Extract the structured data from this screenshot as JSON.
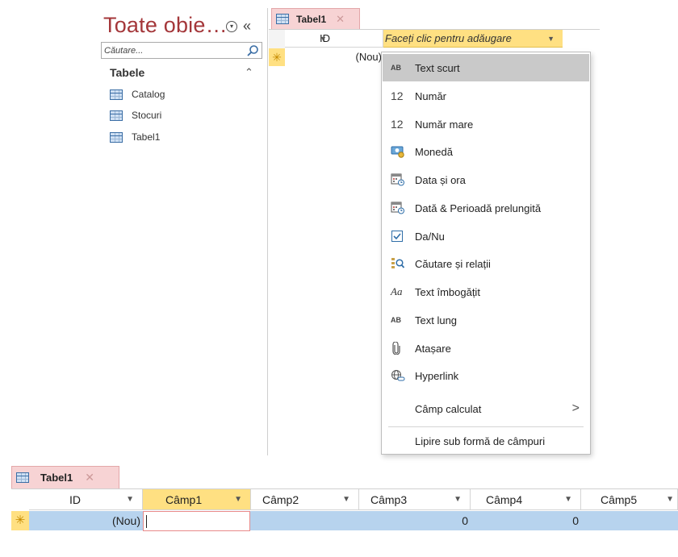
{
  "nav_pane": {
    "title": "Toate obie…",
    "search_placeholder": "Căutare...",
    "group_label": "Tabele",
    "items": [
      {
        "label": "Catalog"
      },
      {
        "label": "Stocuri"
      },
      {
        "label": "Tabel1"
      }
    ]
  },
  "datasheet_top": {
    "tab_label": "Tabel1",
    "id_header": "ID",
    "add_column_header": "Faceți clic pentru adăugare",
    "new_row_value": "(Nou)"
  },
  "field_type_menu": {
    "items": [
      {
        "icon": "short-text-icon",
        "icon_text": "AB",
        "label": "Text scurt",
        "highlighted": true
      },
      {
        "icon": "number-icon",
        "icon_text": "12",
        "label": "Număr"
      },
      {
        "icon": "large-number-icon",
        "icon_text": "12",
        "label": "Număr mare"
      },
      {
        "icon": "currency-icon",
        "label": "Monedă"
      },
      {
        "icon": "date-time-icon",
        "label": "Data și ora"
      },
      {
        "icon": "date-extended-icon",
        "label": "Dată & Perioadă prelungită"
      },
      {
        "icon": "checkbox-icon",
        "label": "Da/Nu"
      },
      {
        "icon": "lookup-icon",
        "label": "Căutare și relații"
      },
      {
        "icon": "rich-text-icon",
        "icon_text": "Aa",
        "label": "Text îmbogățit"
      },
      {
        "icon": "long-text-icon",
        "icon_text": "AB",
        "label": "Text lung"
      },
      {
        "icon": "attachment-icon",
        "label": "Atașare"
      },
      {
        "icon": "hyperlink-icon",
        "label": "Hyperlink"
      },
      {
        "icon": "",
        "label": "Câmp calculat",
        "has_submenu": true
      },
      {
        "icon": "",
        "label": "Lipire sub formă de câmpuri"
      }
    ]
  },
  "datasheet_bottom": {
    "tab_label": "Tabel1",
    "columns": [
      "ID",
      "Câmp1",
      "Câmp2",
      "Câmp3",
      "Câmp4",
      "Câmp5"
    ],
    "new_row": [
      "(Nou)",
      "",
      "",
      "0",
      "0",
      ""
    ]
  },
  "colors": {
    "nav_title": "#a4373a",
    "active_header": "#ffe082",
    "tab_background": "#f7d3d4",
    "selected_row": "#b7d3ee",
    "menu_highlight": "#c9c9c9"
  }
}
